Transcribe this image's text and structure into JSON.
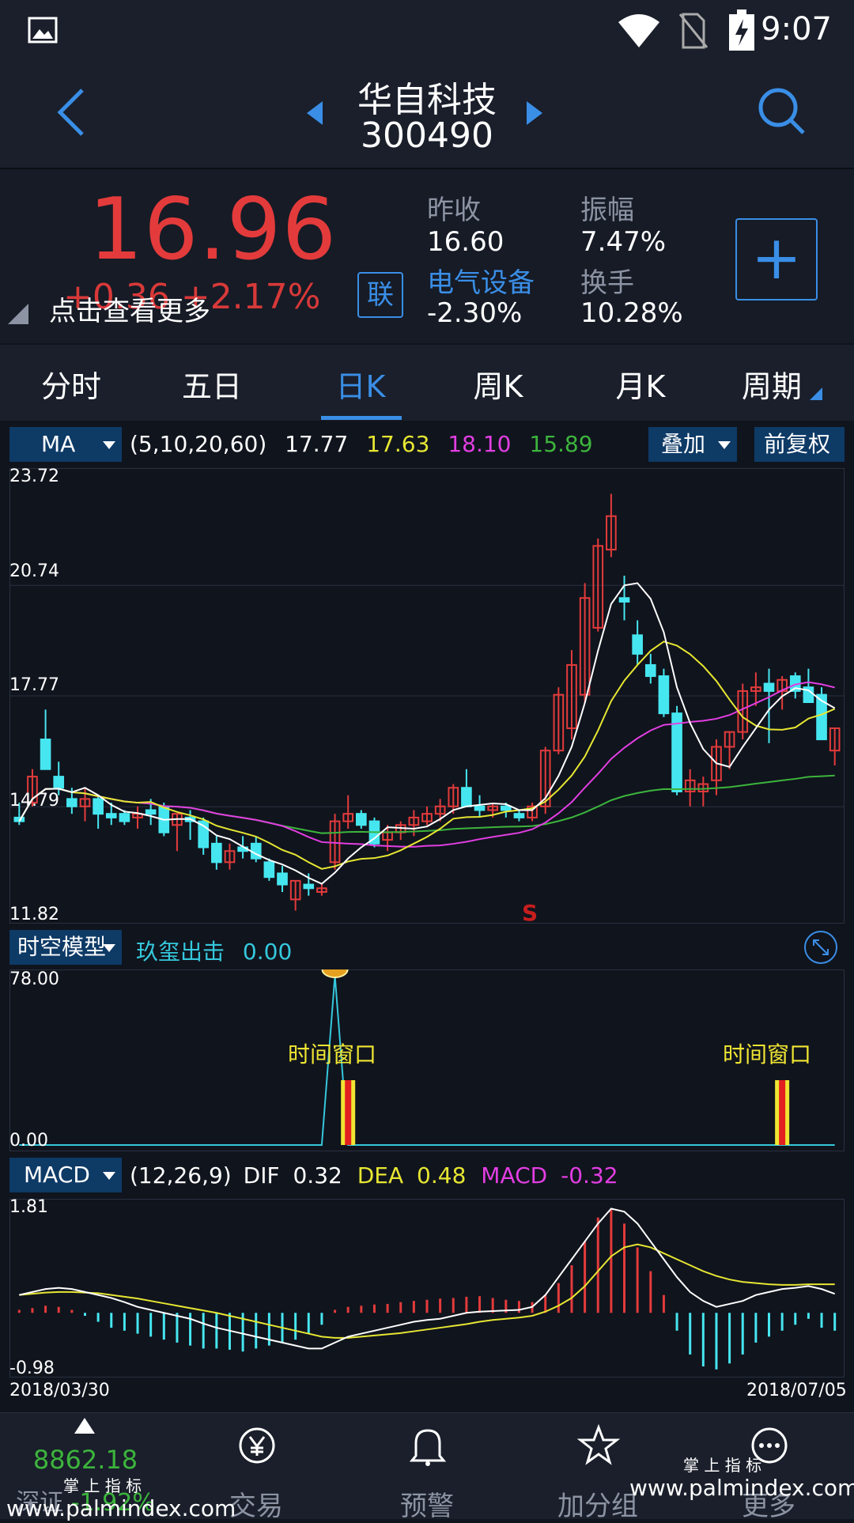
{
  "status": {
    "time": "9:07"
  },
  "header": {
    "name": "华自科技",
    "code": "300490"
  },
  "quote": {
    "price": "16.96",
    "change": "+0.36  +2.17%",
    "tap_more": "点击查看更多",
    "lian_badge": "联",
    "prev_close_label": "昨收",
    "prev_close": "16.60",
    "sector_label": "电气设备",
    "sector_change": "-2.30%",
    "amplitude_label": "振幅",
    "amplitude": "7.47%",
    "turnover_label": "换手",
    "turnover": "10.28%",
    "add_button": "+"
  },
  "tabs": [
    "分时",
    "五日",
    "日K",
    "周K",
    "月K",
    "周期"
  ],
  "ma_bar": {
    "selector": "MA",
    "params": "(5,10,20,60)",
    "v1": "17.77",
    "v2": "17.63",
    "v3": "18.10",
    "v4": "15.89",
    "overlay": "叠加",
    "adjust": "前复权",
    "colors": {
      "ma5": "#ffffff",
      "ma10": "#e6e632",
      "ma20": "#e23ee2",
      "ma60": "#3cb43c"
    }
  },
  "kline_axis": {
    "top": "23.72",
    "l2": "20.74",
    "l3": "17.77",
    "l4": "14.79",
    "bottom": "11.82",
    "marker": "S"
  },
  "model_bar": {
    "selector": "时空模型",
    "name": "玖玺出击",
    "value": "0.00"
  },
  "model_axis": {
    "top": "78.00",
    "bottom": "0.00",
    "window1": "时间窗口",
    "window2": "时间窗口"
  },
  "macd_bar": {
    "selector": "MACD",
    "params": "(12,26,9)",
    "dif_label": "DIF",
    "dif": "0.32",
    "dea_label": "DEA",
    "dea": "0.48",
    "macd_label": "MACD",
    "macd": "-0.32"
  },
  "macd_axis": {
    "top": "1.81",
    "bottom": "-0.98",
    "date_start": "2018/03/30",
    "date_end": "2018/07/05"
  },
  "bottom_nav": {
    "index_value": "8862.18",
    "index_name": "深证",
    "index_change": "-1.92%",
    "trade": "交易",
    "alert": "预警",
    "watchlist": "加分组",
    "more": "更多"
  },
  "watermark": {
    "brand": "掌 上 指 标",
    "url": "www.palmindex.com"
  },
  "chart_data": {
    "type": "candlestick",
    "ylim": [
      11.82,
      23.72
    ],
    "candles": [
      [
        14.5,
        14.9,
        14.3,
        14.4
      ],
      [
        14.9,
        15.8,
        14.8,
        15.6
      ],
      [
        16.6,
        17.4,
        16.0,
        15.8
      ],
      [
        15.6,
        16.0,
        15.1,
        15.3
      ],
      [
        15.0,
        15.3,
        14.6,
        14.8
      ],
      [
        14.8,
        15.3,
        14.4,
        15.0
      ],
      [
        15.0,
        15.1,
        14.2,
        14.6
      ],
      [
        14.6,
        14.9,
        14.3,
        14.5
      ],
      [
        14.6,
        14.7,
        14.3,
        14.4
      ],
      [
        14.5,
        14.8,
        14.2,
        14.6
      ],
      [
        14.7,
        15.0,
        14.3,
        14.6
      ],
      [
        14.8,
        14.9,
        14.0,
        14.1
      ],
      [
        14.3,
        14.6,
        13.6,
        14.6
      ],
      [
        14.5,
        14.7,
        13.9,
        14.4
      ],
      [
        14.4,
        14.5,
        13.5,
        13.7
      ],
      [
        13.8,
        14.0,
        13.1,
        13.3
      ],
      [
        13.3,
        13.8,
        13.1,
        13.6
      ],
      [
        13.7,
        14.0,
        13.4,
        13.6
      ],
      [
        13.8,
        14.0,
        13.3,
        13.4
      ],
      [
        13.3,
        13.4,
        12.8,
        12.9
      ],
      [
        13.0,
        13.2,
        12.5,
        12.7
      ],
      [
        12.3,
        12.8,
        12.0,
        12.8
      ],
      [
        12.7,
        13.0,
        12.4,
        12.6
      ],
      [
        12.5,
        12.7,
        12.4,
        12.6
      ],
      [
        13.3,
        14.6,
        13.1,
        14.4
      ],
      [
        14.4,
        15.1,
        14.2,
        14.6
      ],
      [
        14.6,
        14.7,
        14.2,
        14.3
      ],
      [
        14.4,
        14.5,
        13.7,
        13.8
      ],
      [
        13.9,
        14.3,
        13.6,
        14.1
      ],
      [
        14.1,
        14.4,
        13.9,
        14.3
      ],
      [
        14.3,
        14.7,
        14.0,
        14.5
      ],
      [
        14.4,
        14.8,
        14.3,
        14.6
      ],
      [
        14.6,
        15.0,
        14.4,
        14.8
      ],
      [
        14.8,
        15.4,
        14.6,
        15.3
      ],
      [
        15.3,
        15.8,
        15.1,
        14.8
      ],
      [
        14.8,
        15.1,
        14.5,
        14.7
      ],
      [
        14.7,
        14.9,
        14.5,
        14.8
      ],
      [
        14.8,
        14.9,
        14.5,
        14.7
      ],
      [
        14.6,
        14.7,
        14.4,
        14.5
      ],
      [
        14.5,
        14.9,
        14.4,
        14.8
      ],
      [
        14.8,
        16.4,
        14.6,
        16.3
      ],
      [
        16.3,
        18.0,
        16.2,
        17.8
      ],
      [
        16.9,
        19.0,
        16.6,
        18.6
      ],
      [
        17.8,
        20.8,
        17.6,
        20.4
      ],
      [
        19.6,
        22.0,
        19.5,
        21.8
      ],
      [
        21.7,
        23.2,
        21.5,
        22.6
      ],
      [
        20.4,
        21.0,
        19.8,
        20.3
      ],
      [
        19.4,
        19.8,
        18.6,
        18.9
      ],
      [
        18.6,
        18.9,
        18.1,
        18.3
      ],
      [
        18.3,
        18.5,
        17.2,
        17.3
      ],
      [
        17.3,
        17.5,
        15.1,
        15.2
      ],
      [
        15.2,
        15.8,
        14.8,
        15.5
      ],
      [
        15.2,
        15.6,
        14.8,
        15.4
      ],
      [
        15.5,
        16.6,
        15.1,
        16.4
      ],
      [
        16.4,
        16.8,
        15.8,
        16.8
      ],
      [
        16.8,
        18.1,
        16.6,
        17.9
      ],
      [
        17.9,
        18.4,
        17.5,
        18.0
      ],
      [
        18.1,
        18.5,
        16.5,
        17.9
      ],
      [
        17.9,
        18.3,
        17.4,
        18.2
      ],
      [
        18.3,
        18.4,
        17.7,
        17.9
      ],
      [
        18.0,
        18.5,
        17.8,
        17.6
      ],
      [
        17.8,
        18.0,
        16.6,
        16.6
      ],
      [
        16.3,
        16.9,
        15.9,
        16.9
      ]
    ],
    "time_model": {
      "ylim": [
        0,
        78
      ],
      "spike_index": 24,
      "spike_value": 78,
      "windows": [
        25,
        58
      ]
    },
    "macd": {
      "ylim": [
        -0.98,
        1.81
      ],
      "hist": [
        0.05,
        0.08,
        0.12,
        0.1,
        0.05,
        -0.05,
        -0.15,
        -0.25,
        -0.3,
        -0.35,
        -0.4,
        -0.45,
        -0.5,
        -0.55,
        -0.6,
        -0.6,
        -0.62,
        -0.65,
        -0.6,
        -0.55,
        -0.5,
        -0.45,
        -0.35,
        -0.2,
        0.05,
        0.1,
        0.12,
        0.14,
        0.15,
        0.18,
        0.2,
        0.22,
        0.24,
        0.25,
        0.27,
        0.28,
        0.25,
        0.22,
        0.2,
        0.18,
        0.3,
        0.5,
        0.8,
        1.2,
        1.6,
        1.75,
        1.5,
        1.1,
        0.7,
        0.3,
        -0.3,
        -0.7,
        -0.9,
        -0.95,
        -0.85,
        -0.7,
        -0.5,
        -0.4,
        -0.3,
        -0.2,
        -0.1,
        -0.25,
        -0.3
      ],
      "dif": [
        0.3,
        0.35,
        0.4,
        0.42,
        0.4,
        0.35,
        0.3,
        0.25,
        0.18,
        0.1,
        0.05,
        0,
        -0.05,
        -0.1,
        -0.18,
        -0.25,
        -0.3,
        -0.35,
        -0.4,
        -0.45,
        -0.5,
        -0.55,
        -0.6,
        -0.6,
        -0.5,
        -0.4,
        -0.35,
        -0.3,
        -0.25,
        -0.2,
        -0.15,
        -0.12,
        -0.1,
        -0.05,
        0,
        0.02,
        0.03,
        0.04,
        0.05,
        0.1,
        0.3,
        0.6,
        0.9,
        1.2,
        1.5,
        1.75,
        1.7,
        1.5,
        1.2,
        0.9,
        0.6,
        0.35,
        0.2,
        0.1,
        0.15,
        0.2,
        0.3,
        0.35,
        0.4,
        0.42,
        0.45,
        0.4,
        0.32
      ],
      "dea": [
        0.3,
        0.32,
        0.34,
        0.35,
        0.35,
        0.34,
        0.33,
        0.3,
        0.27,
        0.24,
        0.2,
        0.16,
        0.12,
        0.08,
        0.04,
        0,
        -0.05,
        -0.1,
        -0.15,
        -0.2,
        -0.25,
        -0.3,
        -0.35,
        -0.4,
        -0.42,
        -0.42,
        -0.4,
        -0.38,
        -0.36,
        -0.34,
        -0.31,
        -0.28,
        -0.25,
        -0.22,
        -0.19,
        -0.15,
        -0.12,
        -0.1,
        -0.08,
        -0.05,
        0.02,
        0.12,
        0.25,
        0.45,
        0.7,
        0.95,
        1.1,
        1.15,
        1.1,
        1.0,
        0.9,
        0.8,
        0.7,
        0.62,
        0.56,
        0.52,
        0.5,
        0.48,
        0.47,
        0.47,
        0.48,
        0.48,
        0.48
      ]
    }
  }
}
